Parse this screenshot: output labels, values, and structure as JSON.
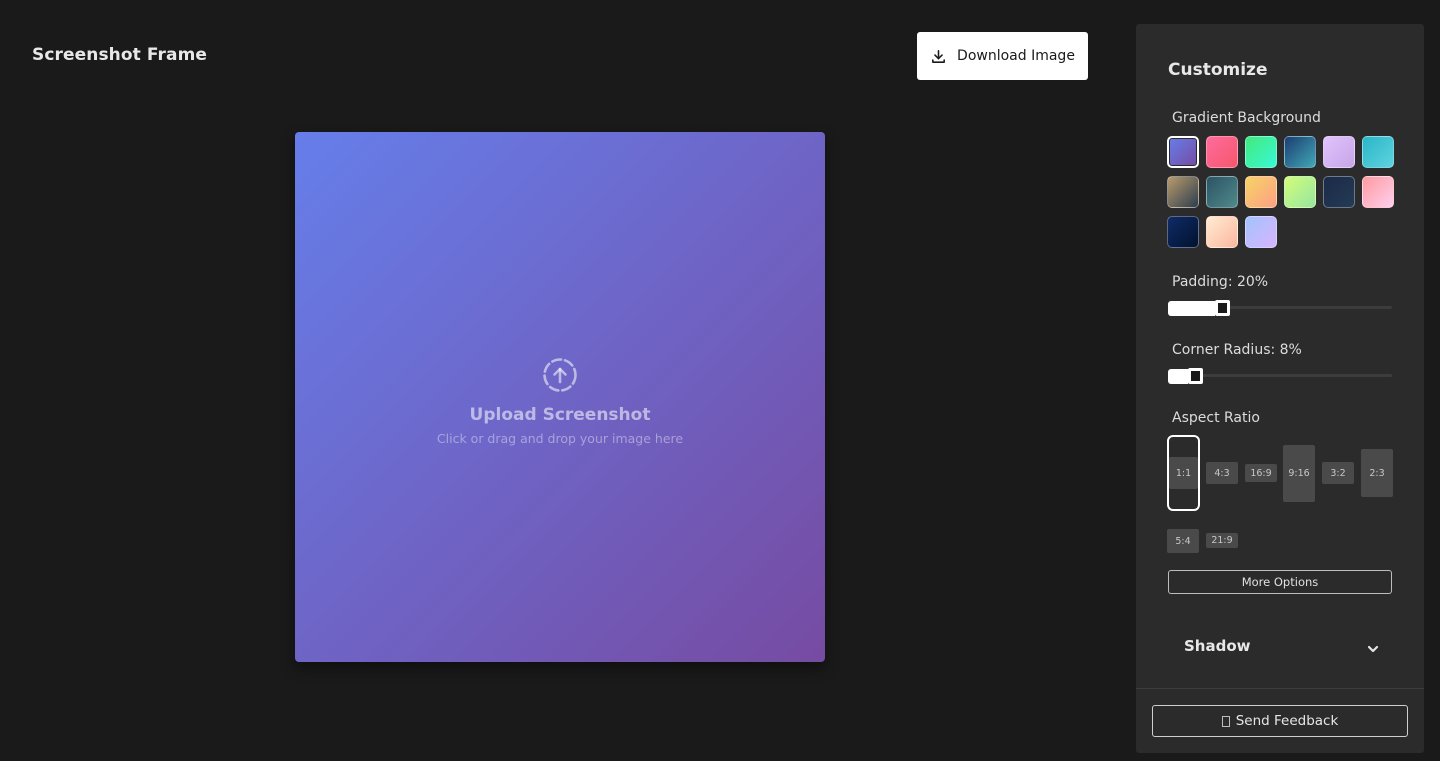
{
  "header": {
    "title": "Screenshot Frame",
    "download_label": "Download Image"
  },
  "canvas": {
    "upload_title": "Upload Screenshot",
    "upload_subtitle": "Click or drag and drop your image here",
    "gradient_start": "#667eea",
    "gradient_end": "#764ba2"
  },
  "panel": {
    "title": "Customize",
    "gradient_label": "Gradient Background",
    "gradients": [
      {
        "from": "#667eea",
        "to": "#764ba2",
        "selected": true
      },
      {
        "from": "#ff6b9d",
        "to": "#f5576c",
        "selected": false
      },
      {
        "from": "#43e97b",
        "to": "#38f9d7",
        "selected": false
      },
      {
        "from": "#1e3c72",
        "to": "#3fa9b5",
        "selected": false
      },
      {
        "from": "#e0c3fc",
        "to": "#c7a5e8",
        "selected": false
      },
      {
        "from": "#2bb6c7",
        "to": "#5ed3e0",
        "selected": false
      },
      {
        "from": "#b99a6b",
        "to": "#2c3e50",
        "selected": false
      },
      {
        "from": "#2c5364",
        "to": "#4f8a8b",
        "selected": false
      },
      {
        "from": "#f6d365",
        "to": "#fda085",
        "selected": false
      },
      {
        "from": "#d4fc79",
        "to": "#96e6a1",
        "selected": false
      },
      {
        "from": "#1b2a47",
        "to": "#243b55",
        "selected": false
      },
      {
        "from": "#ff9a9e",
        "to": "#fecfef",
        "selected": false
      },
      {
        "from": "#0f2c67",
        "to": "#02122e",
        "selected": false
      },
      {
        "from": "#ffecd2",
        "to": "#fcb69f",
        "selected": false
      },
      {
        "from": "#a1c4fd",
        "to": "#d8b4fe",
        "selected": false
      }
    ],
    "padding_label": "Padding: 20%",
    "padding_value": 0.2,
    "radius_label": "Corner Radius: 8%",
    "radius_value": 0.08,
    "aspect_label": "Aspect Ratio",
    "aspect_ratios": [
      "1:1",
      "4:3",
      "16:9",
      "9:16",
      "3:2",
      "2:3",
      "5:4",
      "21:9"
    ],
    "aspect_selected": "1:1",
    "more_options_label": "More Options",
    "shadow_label": "Shadow",
    "feedback_label": "Send Feedback"
  }
}
